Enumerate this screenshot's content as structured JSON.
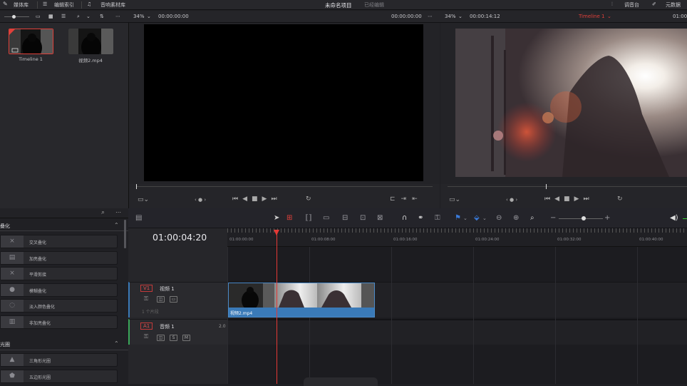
{
  "topbar": {
    "media_pool": "媒体库",
    "edit_index": "编辑索引",
    "sound_library": "音响素材库",
    "project_title": "未命名项目",
    "edited_status": "已经编辑",
    "mixer": "调音台",
    "metadata": "元数据"
  },
  "source_viewer": {
    "zoom": "34%",
    "timecode_left": "00:00:00:00",
    "timecode_right": "00:00:00:00"
  },
  "timeline_viewer": {
    "zoom": "34%",
    "duration": "00:00:14:12",
    "timeline_name": "Timeline 1",
    "timecode": "01:00"
  },
  "media_pool": {
    "clips": [
      {
        "name": "Timeline 1"
      },
      {
        "name": "视频2.mp4"
      }
    ]
  },
  "effects": {
    "section_transitions": "叠化",
    "items": [
      {
        "label": "交叉叠化",
        "icon": "cross-dissolve-icon",
        "glyph": "⨯"
      },
      {
        "label": "加亮叠化",
        "icon": "additive-dissolve-icon",
        "glyph": "▤"
      },
      {
        "label": "平滑剪接",
        "icon": "smooth-cut-icon",
        "glyph": "⨯"
      },
      {
        "label": "模糊叠化",
        "icon": "blur-dissolve-icon",
        "glyph": "●"
      },
      {
        "label": "淡入颜色叠化",
        "icon": "dip-to-color-icon",
        "glyph": "◌"
      },
      {
        "label": "非加亮叠化",
        "icon": "non-additive-dissolve-icon",
        "glyph": "▥"
      }
    ],
    "section_iris": "光圈",
    "iris_items": [
      {
        "label": "三角形光圈",
        "icon": "triangle-iris-icon",
        "glyph": "▲"
      },
      {
        "label": "五边形光圈",
        "icon": "pentagon-iris-icon",
        "glyph": "⬟"
      }
    ]
  },
  "timeline": {
    "current_timecode": "01:00:04:20",
    "ruler": [
      "01:00:00:00",
      "01:00:08:00",
      "01:00:16:00",
      "01:00:24:00",
      "01:00:32:00",
      "01:00:40:00"
    ],
    "video_track": {
      "badge": "V1",
      "name": "视频 1",
      "clip_count": "1 个片段"
    },
    "audio_track": {
      "badge": "A1",
      "name": "音频 1",
      "level": "2.0",
      "solo": "S",
      "mute": "M"
    },
    "clip_name": "视频2.mp4"
  },
  "colors": {
    "accent_red": "#e0403a",
    "clip_blue": "#3a7ab8",
    "playhead": "#e53935"
  }
}
